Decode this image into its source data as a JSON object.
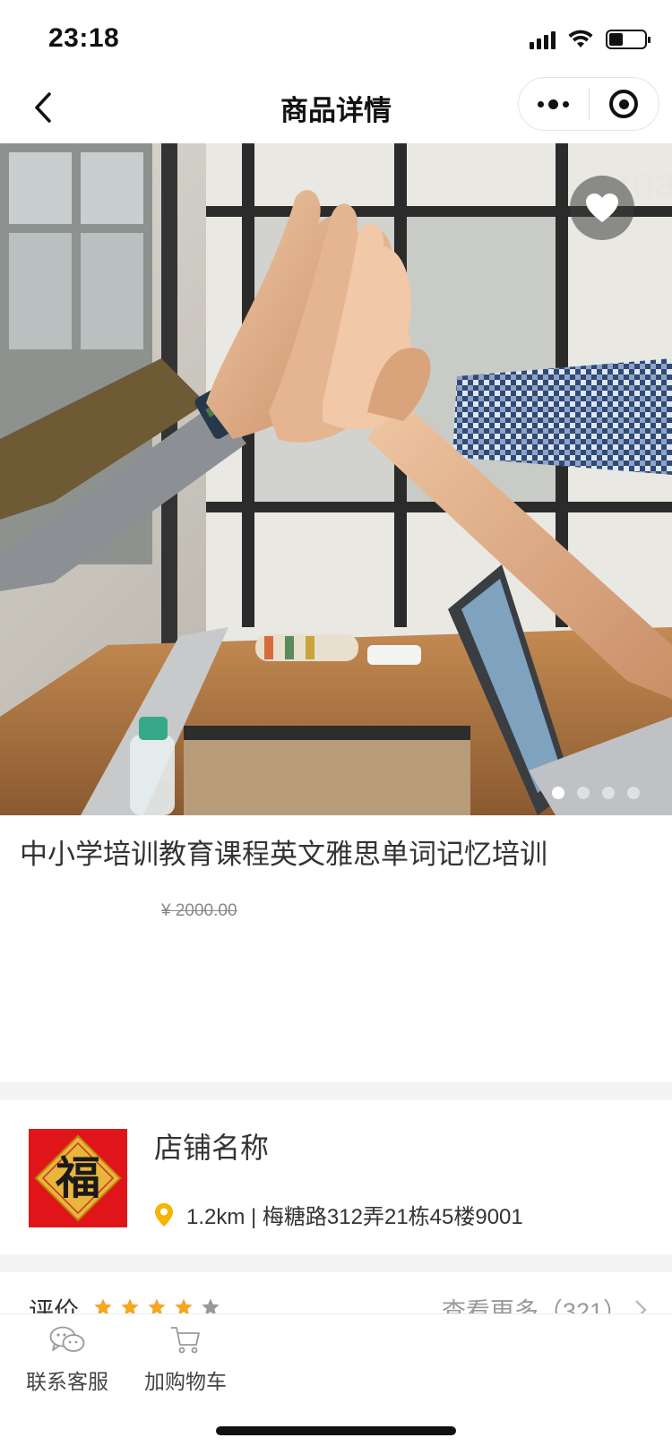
{
  "status_bar": {
    "time": "23:18",
    "battery_level": 0.4,
    "icons": [
      "signal-icon",
      "wifi-icon",
      "battery-icon"
    ]
  },
  "nav": {
    "title": "商品详情",
    "back_icon": "chevron-left-icon",
    "more_icon": "more-dots-icon",
    "close_icon": "target-icon"
  },
  "hero": {
    "favorite_icon": "heart-icon",
    "slide_count": 4,
    "active_slide": 1
  },
  "product": {
    "title": "中小学培训教育课程英文雅思单词记忆培训",
    "original_price": "¥ 2000.00"
  },
  "store": {
    "name": "店铺名称",
    "logo_char": "福",
    "location_icon": "location-pin-icon",
    "address": "1.2km | 梅糖路312弄21栋45楼9001"
  },
  "reviews": {
    "label": "评价",
    "rating": 4,
    "max_rating": 5,
    "more_text": "查看更多（321）"
  },
  "bottom_bar": {
    "items": [
      {
        "label": "联系客服",
        "icon": "chat-bubbles-icon"
      },
      {
        "label": "加购物车",
        "icon": "cart-icon"
      }
    ]
  },
  "colors": {
    "star_active": "#f5a623",
    "star_inactive": "#999999",
    "location_pin": "#f5b400",
    "store_logo_red": "#e0151a",
    "section_gap": "#f4f4f4"
  }
}
